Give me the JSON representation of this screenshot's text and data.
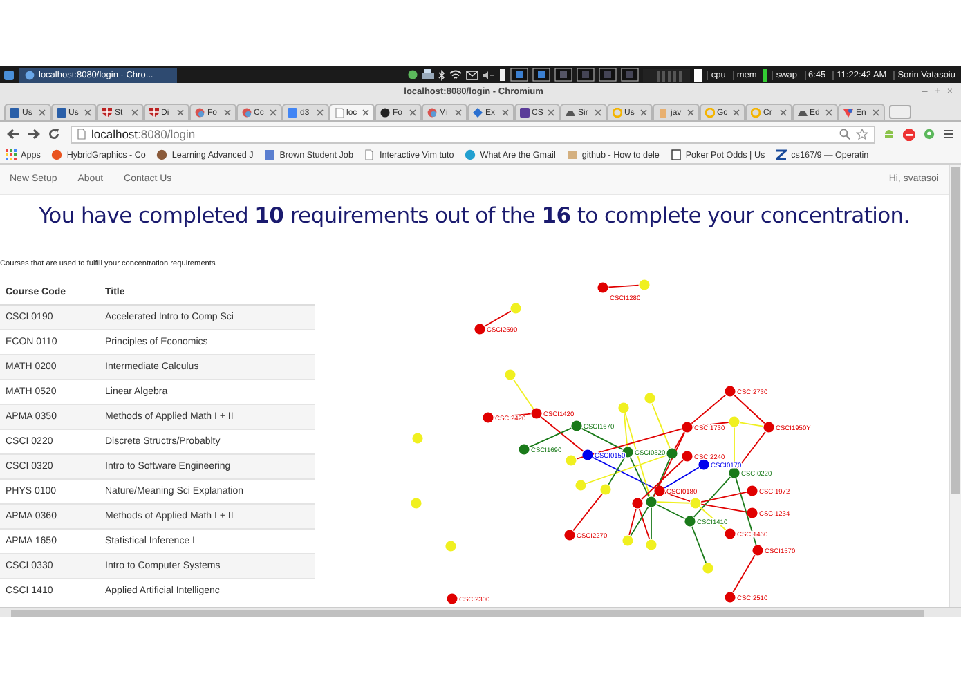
{
  "taskbar": {
    "window_button": "localhost:8080/login - Chro...",
    "monitors": [
      "cpu",
      "mem",
      "swap"
    ],
    "uptime": "6:45",
    "clock": "11:22:42 AM",
    "user": "Sorin Vatasoiu"
  },
  "window": {
    "title": "localhost:8080/login - Chromium",
    "controls": [
      "–",
      "+",
      "×"
    ]
  },
  "tabs": [
    {
      "label": "Us",
      "selected": false
    },
    {
      "label": "Us",
      "selected": false
    },
    {
      "label": "St",
      "selected": false
    },
    {
      "label": "Di",
      "selected": false
    },
    {
      "label": "Fo",
      "selected": false
    },
    {
      "label": "Cc",
      "selected": false
    },
    {
      "label": "d3",
      "selected": false
    },
    {
      "label": "loc",
      "selected": true
    },
    {
      "label": "Fo",
      "selected": false
    },
    {
      "label": "Mi",
      "selected": false
    },
    {
      "label": "Ex",
      "selected": false
    },
    {
      "label": "CS",
      "selected": false
    },
    {
      "label": "Sir",
      "selected": false
    },
    {
      "label": "Us",
      "selected": false
    },
    {
      "label": "jav",
      "selected": false
    },
    {
      "label": "Gc",
      "selected": false
    },
    {
      "label": "Cr",
      "selected": false
    },
    {
      "label": "Ed",
      "selected": false
    },
    {
      "label": "En",
      "selected": false
    }
  ],
  "address": {
    "value": "**localhost**:8080/login"
  },
  "bookmarks": [
    "Apps",
    "HybridGraphics - Co",
    "Learning Advanced J",
    "Brown Student Job",
    "Interactive Vim tuto",
    "What Are the Gmail",
    "github - How to dele",
    "Poker Pot Odds | Us",
    "cs167/9 — Operatin"
  ],
  "nav": {
    "links": [
      "New Setup",
      "About",
      "Contact Us"
    ],
    "greeting": "Hi, svatasoi"
  },
  "heading": "You have completed **10** requirements out of the **16** to complete your concentration.",
  "caption": "Courses that are used to fulfill your concentration requirements",
  "table": {
    "columns": [
      "Course Code",
      "Title"
    ],
    "rows": [
      [
        "CSCI 0190",
        "Accelerated Intro to Comp Sci"
      ],
      [
        "ECON 0110",
        "Principles of Economics"
      ],
      [
        "MATH 0200",
        "Intermediate Calculus"
      ],
      [
        "MATH 0520",
        "Linear Algebra"
      ],
      [
        "APMA 0350",
        "Methods of Applied Math I + II"
      ],
      [
        "CSCI 0220",
        "Discrete Structrs/Probablty"
      ],
      [
        "CSCI 0320",
        "Intro to Software Engineering"
      ],
      [
        "PHYS 0100",
        "Nature/Meaning Sci Explanation"
      ],
      [
        "APMA 0360",
        "Methods of Applied Math I + II"
      ],
      [
        "APMA 1650",
        "Statistical Inference I"
      ],
      [
        "CSCI 0330",
        "Intro to Computer Systems"
      ],
      [
        "CSCI 1410",
        "Applied Artificial Intelligenc"
      ]
    ]
  },
  "graph": {
    "nodes": [
      {
        "label": "CSCI1280",
        "color": "#e00000"
      },
      {
        "color": "#f0f020"
      },
      {
        "color": "#f0f020"
      },
      {
        "label": "CSCI2590",
        "color": "#e00000"
      },
      {
        "color": "#f0f020"
      },
      {
        "label": "CSCI2420",
        "color": "#e00000"
      },
      {
        "label": "CSCI1420",
        "color": "#e00000"
      },
      {
        "label": "CSCI1670",
        "color": "#1a7a1a"
      },
      {
        "label": "CSCI1690",
        "color": "#1a7a1a"
      },
      {
        "label": "CSCI0150",
        "color": "#0000ee"
      },
      {
        "color": "#f0f020"
      },
      {
        "label": "CSCI0320",
        "color": "#1a7a1a"
      },
      {
        "color": "#1a7a1a"
      },
      {
        "color": "#f0f020"
      },
      {
        "color": "#f0f020"
      },
      {
        "color": "#f0f020"
      },
      {
        "color": "#f0f020"
      },
      {
        "color": "#f0f020"
      },
      {
        "color": "#f0f020"
      },
      {
        "label": "CSCI0180",
        "color": "#e00000"
      },
      {
        "color": "#e00000"
      },
      {
        "color": "#1a7a1a"
      },
      {
        "label": "CSCI2270",
        "color": "#e00000"
      },
      {
        "color": "#f0f020"
      },
      {
        "color": "#f0f020"
      },
      {
        "color": "#f0f020"
      },
      {
        "label": "CSCI2300",
        "color": "#e00000"
      },
      {
        "label": "CSCI2730",
        "color": "#e00000"
      },
      {
        "label": "CSCI1730",
        "color": "#e00000"
      },
      {
        "color": "#f0f020"
      },
      {
        "label": "CSCI1950Y",
        "color": "#e00000"
      },
      {
        "label": "CSCI2240",
        "color": "#e00000"
      },
      {
        "label": "CSCI0170",
        "color": "#0000ee"
      },
      {
        "label": "CSCI0220",
        "color": "#1a7a1a"
      },
      {
        "label": "CSCI1972",
        "color": "#e00000"
      },
      {
        "color": "#f0f020"
      },
      {
        "label": "CSCI1234",
        "color": "#e00000"
      },
      {
        "label": "CSCI1410",
        "color": "#1a7a1a"
      },
      {
        "label": "CSCI1460",
        "color": "#e00000"
      },
      {
        "label": "CSCI1570",
        "color": "#e00000"
      },
      {
        "color": "#f0f020"
      },
      {
        "label": "CSCI2510",
        "color": "#e00000"
      }
    ]
  }
}
